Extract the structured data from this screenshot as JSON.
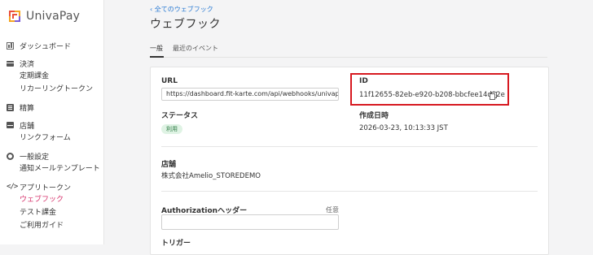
{
  "app": {
    "name": "UnivaPay"
  },
  "sidebar": {
    "sections": [
      {
        "label": "ダッシュボード",
        "icon": "dashboard-icon",
        "items": []
      },
      {
        "label": "決済",
        "icon": "credit-card-icon",
        "items": [
          "定期課金",
          "リカーリングトークン"
        ]
      },
      {
        "label": "精算",
        "icon": "ledger-icon",
        "items": []
      },
      {
        "label": "店舗",
        "icon": "store-icon",
        "items": [
          "リンクフォーム"
        ]
      },
      {
        "label": "一般設定",
        "icon": "gear-icon",
        "items": [
          "通知メールテンプレート"
        ]
      },
      {
        "label": "アプリトークン",
        "icon": "code-icon",
        "items": [
          "ウェブフック",
          "テスト課金",
          "ご利用ガイド"
        ]
      }
    ],
    "active_item": "ウェブフック"
  },
  "header": {
    "breadcrumb": "‹ 全てのウェブフック",
    "title": "ウェブフック"
  },
  "tabs": [
    {
      "label": "一般",
      "active": true
    },
    {
      "label": "最近のイベント",
      "active": false
    }
  ],
  "details": {
    "url_label": "URL",
    "url_value": "https://dashboard.fit-karte.com/api/webhooks/univap",
    "id_label": "ID",
    "id_value": "11f12655-82eb-e920-b208-bbcfee14d92e",
    "status_label": "ステータス",
    "status_value": "利用",
    "created_label": "作成日時",
    "created_value": "2026-03-23, 10:13:33 JST",
    "store_label": "店舗",
    "store_value": "株式会社Amelio_STOREDEMO",
    "auth_label": "Authorizationヘッダー",
    "auth_optional": "任意",
    "auth_value": "",
    "trigger_label": "トリガー"
  },
  "colors": {
    "accent": "#d6336c",
    "link": "#2b7bd3",
    "highlight_border": "#d71920",
    "status_bg": "#dff3e4"
  }
}
